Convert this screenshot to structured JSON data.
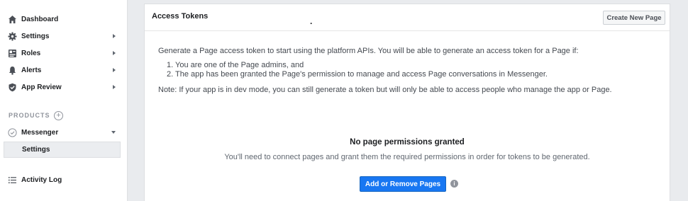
{
  "sidebar": {
    "items": [
      {
        "label": "Dashboard",
        "icon": "home-icon"
      },
      {
        "label": "Settings",
        "icon": "gear-icon"
      },
      {
        "label": "Roles",
        "icon": "roles-icon"
      },
      {
        "label": "Alerts",
        "icon": "bell-icon"
      },
      {
        "label": "App Review",
        "icon": "shield-check-icon"
      }
    ],
    "products_label": "PRODUCTS",
    "products_add_glyph": "+",
    "messenger": {
      "label": "Messenger",
      "icon": "check-circle-icon"
    },
    "messenger_sub": {
      "label": "Settings"
    },
    "activity_log": {
      "label": "Activity Log",
      "icon": "list-icon"
    }
  },
  "panel": {
    "title": "Access Tokens",
    "header_dot": ".",
    "create_button": "Create New Page",
    "intro": "Generate a Page access token to start using the platform APIs. You will be able to generate an access token for a Page if:",
    "conditions": [
      "1. You are one of the Page admins, and",
      "2. The app has been granted the Page's permission to manage and access Page conversations in Messenger."
    ],
    "note": "Note: If your app is in dev mode, you can still generate a token but will only be able to access people who manage the app or Page.",
    "empty_title": "No page permissions granted",
    "empty_desc": "You'll need to connect pages and grant them the required permissions in order for tokens to be generated.",
    "primary_button": "Add or Remove Pages",
    "info_glyph": "i"
  },
  "colors": {
    "primary": "#1877f2",
    "background": "#e9ebee",
    "sidebar_bg": "#ffffff",
    "selected_bg": "#ebedf0"
  }
}
